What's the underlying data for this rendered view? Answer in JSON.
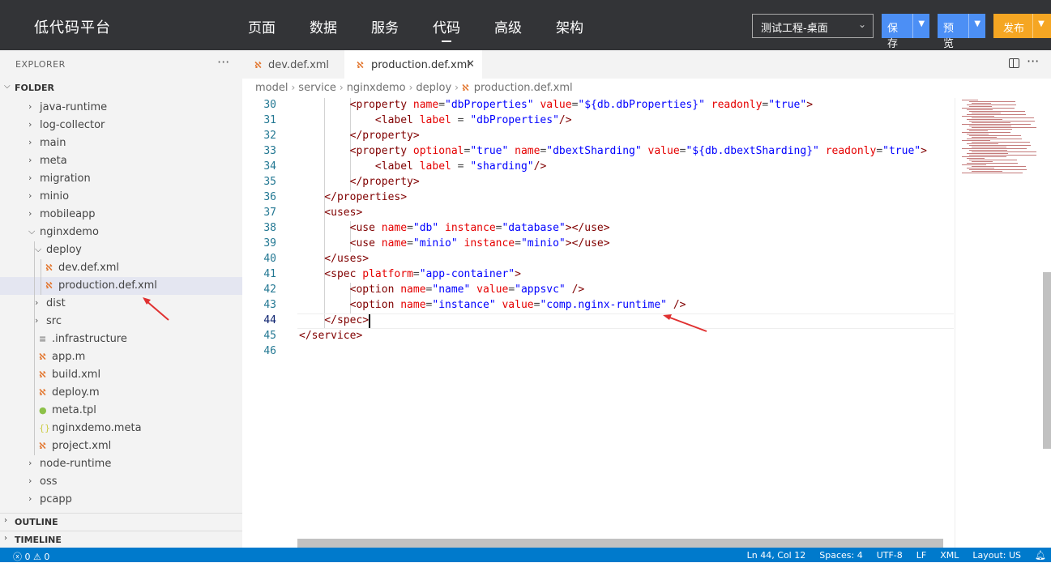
{
  "header": {
    "brand": "低代码平台",
    "nav": [
      "页面",
      "数据",
      "服务",
      "代码",
      "高级",
      "架构"
    ],
    "active_nav": "代码",
    "project_select": "测试工程-桌面",
    "buttons": {
      "save": "保存",
      "preview": "预览",
      "publish": "发布"
    },
    "colors": {
      "bar": "#333437",
      "save": "#4c8ff5",
      "publish": "#f5a623"
    }
  },
  "sidebar": {
    "title": "EXPLORER",
    "folder_label": "FOLDER",
    "outline_label": "OUTLINE",
    "timeline_label": "TIMELINE",
    "tree": [
      {
        "label": "java-runtime",
        "kind": "folder"
      },
      {
        "label": "log-collector",
        "kind": "folder"
      },
      {
        "label": "main",
        "kind": "folder"
      },
      {
        "label": "meta",
        "kind": "folder"
      },
      {
        "label": "migration",
        "kind": "folder"
      },
      {
        "label": "minio",
        "kind": "folder"
      },
      {
        "label": "mobileapp",
        "kind": "folder"
      },
      {
        "label": "nginxdemo",
        "kind": "folder-open"
      },
      {
        "label": "deploy",
        "kind": "folder-open"
      },
      {
        "label": "dev.def.xml",
        "kind": "rss-icon"
      },
      {
        "label": "production.def.xml",
        "kind": "rss-icon"
      },
      {
        "label": "dist",
        "kind": "folder"
      },
      {
        "label": "src",
        "kind": "folder"
      },
      {
        "label": ".infrastructure",
        "kind": "lines-icon"
      },
      {
        "label": "app.m",
        "kind": "rss-icon"
      },
      {
        "label": "build.xml",
        "kind": "rss-icon"
      },
      {
        "label": "deploy.m",
        "kind": "rss-icon"
      },
      {
        "label": "meta.tpl",
        "kind": "bulb-icon"
      },
      {
        "label": "nginxdemo.meta",
        "kind": "braces-icon"
      },
      {
        "label": "project.xml",
        "kind": "rss-icon"
      },
      {
        "label": "node-runtime",
        "kind": "folder"
      },
      {
        "label": "oss",
        "kind": "folder"
      },
      {
        "label": "pcapp",
        "kind": "folder"
      }
    ]
  },
  "tabs": [
    {
      "label": "dev.def.xml",
      "active": false
    },
    {
      "label": "production.def.xml",
      "active": true
    }
  ],
  "breadcrumb": [
    "model",
    "service",
    "nginxdemo",
    "deploy",
    "production.def.xml"
  ],
  "editor": {
    "lines": [
      {
        "n": "30",
        "tokens": [
          [
            "t",
            "        <property "
          ],
          [
            "a",
            "name"
          ],
          [
            "p",
            "="
          ],
          [
            "v",
            "\"dbProperties\""
          ],
          [
            "p",
            " "
          ],
          [
            "a",
            "value"
          ],
          [
            "p",
            "="
          ],
          [
            "v",
            "\"${db.dbProperties}\""
          ],
          [
            "p",
            " "
          ],
          [
            "a",
            "readonly"
          ],
          [
            "p",
            "="
          ],
          [
            "v",
            "\"true\""
          ],
          [
            "t",
            ">"
          ]
        ]
      },
      {
        "n": "31",
        "tokens": [
          [
            "t",
            "            <label "
          ],
          [
            "a",
            "label"
          ],
          [
            "p",
            " = "
          ],
          [
            "v",
            "\"dbProperties\""
          ],
          [
            "t",
            "/>"
          ]
        ]
      },
      {
        "n": "32",
        "tokens": [
          [
            "t",
            "        </property>"
          ]
        ]
      },
      {
        "n": "33",
        "tokens": [
          [
            "t",
            "        <property "
          ],
          [
            "a",
            "optional"
          ],
          [
            "p",
            "="
          ],
          [
            "v",
            "\"true\""
          ],
          [
            "p",
            " "
          ],
          [
            "a",
            "name"
          ],
          [
            "p",
            "="
          ],
          [
            "v",
            "\"dbextSharding\""
          ],
          [
            "p",
            " "
          ],
          [
            "a",
            "value"
          ],
          [
            "p",
            "="
          ],
          [
            "v",
            "\"${db.dbextSharding}\""
          ],
          [
            "p",
            " "
          ],
          [
            "a",
            "readonly"
          ],
          [
            "p",
            "="
          ],
          [
            "v",
            "\"true\""
          ],
          [
            "t",
            ">"
          ]
        ]
      },
      {
        "n": "34",
        "tokens": [
          [
            "t",
            "            <label "
          ],
          [
            "a",
            "label"
          ],
          [
            "p",
            " = "
          ],
          [
            "v",
            "\"sharding\""
          ],
          [
            "t",
            "/>"
          ]
        ]
      },
      {
        "n": "35",
        "tokens": [
          [
            "t",
            "        </property>"
          ]
        ]
      },
      {
        "n": "36",
        "tokens": [
          [
            "t",
            "    </properties>"
          ]
        ]
      },
      {
        "n": "37",
        "tokens": [
          [
            "t",
            "    <uses>"
          ]
        ]
      },
      {
        "n": "38",
        "tokens": [
          [
            "t",
            "        <use "
          ],
          [
            "a",
            "name"
          ],
          [
            "p",
            "="
          ],
          [
            "v",
            "\"db\""
          ],
          [
            "p",
            " "
          ],
          [
            "a",
            "instance"
          ],
          [
            "p",
            "="
          ],
          [
            "v",
            "\"database\""
          ],
          [
            "t",
            "></use>"
          ]
        ]
      },
      {
        "n": "39",
        "tokens": [
          [
            "t",
            "        <use "
          ],
          [
            "a",
            "name"
          ],
          [
            "p",
            "="
          ],
          [
            "v",
            "\"minio\""
          ],
          [
            "p",
            " "
          ],
          [
            "a",
            "instance"
          ],
          [
            "p",
            "="
          ],
          [
            "v",
            "\"minio\""
          ],
          [
            "t",
            "></use>"
          ]
        ]
      },
      {
        "n": "40",
        "tokens": [
          [
            "t",
            "    </uses>"
          ]
        ]
      },
      {
        "n": "41",
        "tokens": [
          [
            "t",
            "    <spec "
          ],
          [
            "a",
            "platform"
          ],
          [
            "p",
            "="
          ],
          [
            "v",
            "\"app-container\""
          ],
          [
            "t",
            ">"
          ]
        ]
      },
      {
        "n": "42",
        "tokens": [
          [
            "t",
            "        <option "
          ],
          [
            "a",
            "name"
          ],
          [
            "p",
            "="
          ],
          [
            "v",
            "\"name\""
          ],
          [
            "p",
            " "
          ],
          [
            "a",
            "value"
          ],
          [
            "p",
            "="
          ],
          [
            "v",
            "\"appsvc\""
          ],
          [
            "p",
            " "
          ],
          [
            "t",
            "/>"
          ]
        ]
      },
      {
        "n": "43",
        "tokens": [
          [
            "t",
            "        <option "
          ],
          [
            "a",
            "name"
          ],
          [
            "p",
            "="
          ],
          [
            "v",
            "\"instance\""
          ],
          [
            "p",
            " "
          ],
          [
            "a",
            "value"
          ],
          [
            "p",
            "="
          ],
          [
            "v",
            "\"comp.nginx-runtime\""
          ],
          [
            "p",
            " "
          ],
          [
            "t",
            "/>"
          ]
        ]
      },
      {
        "n": "44",
        "tokens": [
          [
            "t",
            "    </spec>"
          ]
        ]
      },
      {
        "n": "45",
        "tokens": [
          [
            "t",
            "</service>"
          ]
        ]
      },
      {
        "n": "46",
        "tokens": []
      }
    ],
    "current_line": "44",
    "colors": {
      "tag": "#800000",
      "attr": "#e50000",
      "value": "#0000ff",
      "line_number": "#237893"
    }
  },
  "statusbar": {
    "errors": "0",
    "warnings": "0",
    "position": "Ln 44, Col 12",
    "spaces": "Spaces: 4",
    "encoding": "UTF-8",
    "eol": "LF",
    "language": "XML",
    "layout": "Layout: US",
    "color": "#007acc"
  },
  "annotation_color": "#e03030"
}
